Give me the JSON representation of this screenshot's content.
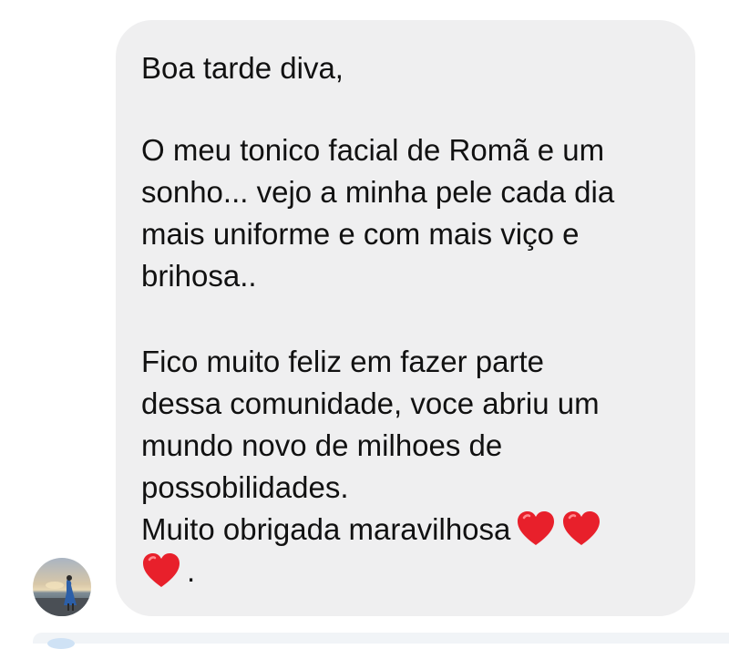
{
  "message": {
    "greeting": "Boa tarde diva,",
    "paragraph1": "O meu tonico facial de Romã e um\nsonho... vejo a minha pele cada dia\nmais uniforme e com mais viço e\nbrihosa..",
    "paragraph2": "Fico muito feliz em fazer parte\ndessa comunidade, voce abriu um\nmundo novo de milhoes de\npossobilidades.",
    "closing": "Muito obrigada maravilhosa",
    "end_mark": ".",
    "emoji": "red-heart-emoji"
  },
  "colors": {
    "bubble_background": "#efeff0",
    "text": "#111111",
    "heart": "#e8202b"
  },
  "avatar": {
    "icon": "user-avatar-beach-photo"
  }
}
